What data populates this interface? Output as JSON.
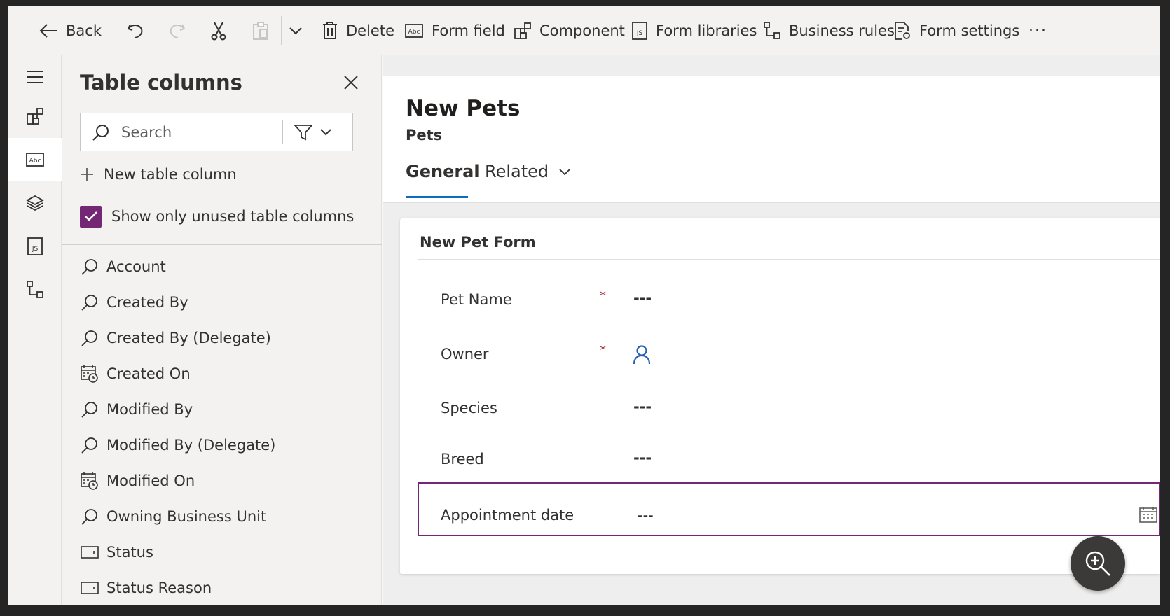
{
  "toolbar": {
    "back": "Back",
    "delete": "Delete",
    "form_field": "Form field",
    "component": "Component",
    "form_libraries": "Form libraries",
    "business_rules": "Business rules",
    "form_settings": "Form settings",
    "more": "···"
  },
  "rail": {
    "items": [
      "hamburger-icon",
      "components-icon",
      "form-field-icon",
      "layers-icon",
      "form-libraries-icon",
      "business-rules-icon"
    ],
    "active_index": 2
  },
  "pane": {
    "title": "Table columns",
    "search_placeholder": "Search",
    "new_column": "New table column",
    "show_unused": "Show only unused table columns",
    "show_unused_checked": true,
    "columns": [
      {
        "label": "Account",
        "icon": "lookup-icon"
      },
      {
        "label": "Created By",
        "icon": "lookup-icon"
      },
      {
        "label": "Created By (Delegate)",
        "icon": "lookup-icon"
      },
      {
        "label": "Created On",
        "icon": "datetime-icon"
      },
      {
        "label": "Modified By",
        "icon": "lookup-icon"
      },
      {
        "label": "Modified By (Delegate)",
        "icon": "lookup-icon"
      },
      {
        "label": "Modified On",
        "icon": "datetime-icon"
      },
      {
        "label": "Owning Business Unit",
        "icon": "lookup-icon"
      },
      {
        "label": "Status",
        "icon": "option-set-icon"
      },
      {
        "label": "Status Reason",
        "icon": "option-set-icon"
      }
    ]
  },
  "form": {
    "title": "New Pets",
    "entity": "Pets",
    "tabs": {
      "general": "General",
      "related": "Related"
    },
    "section_title": "New Pet Form",
    "fields": {
      "pet_name": {
        "label": "Pet Name",
        "required": "*",
        "value": "---"
      },
      "owner": {
        "label": "Owner",
        "required": "*"
      },
      "species": {
        "label": "Species",
        "value": "---"
      },
      "breed": {
        "label": "Breed",
        "value": "---"
      },
      "appointment": {
        "label": "Appointment date",
        "value": "---"
      }
    }
  },
  "colors": {
    "accent_purple": "#742774",
    "tab_underline": "#0f6cbd",
    "required_red": "#a4262c",
    "lookup_blue": "#2b5eb5"
  }
}
